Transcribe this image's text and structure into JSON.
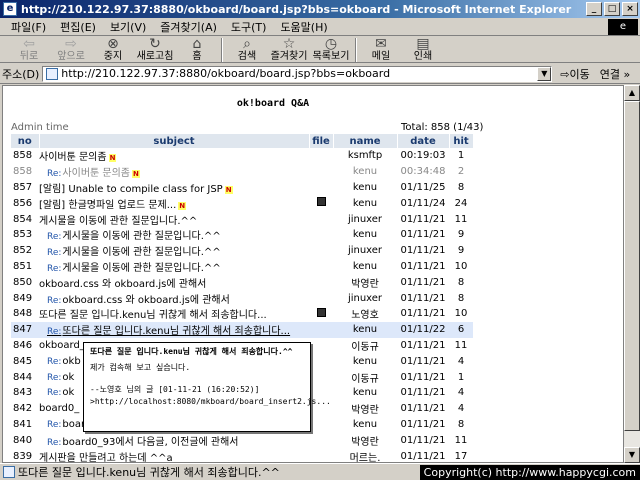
{
  "window": {
    "title": "http://210.122.97.37:8880/okboard/board.jsp?bbs=okboard - Microsoft Internet Explorer"
  },
  "menu": [
    "파일(F)",
    "편집(E)",
    "보기(V)",
    "즐겨찾기(A)",
    "도구(T)",
    "도움말(H)"
  ],
  "toolbar": {
    "back": "뒤로",
    "forward": "앞으로",
    "stop": "중지",
    "refresh": "새로고침",
    "home": "홈",
    "search": "검색",
    "favorites": "즐겨찾기",
    "history": "목록보기",
    "mail": "메일",
    "print": "인쇄"
  },
  "address": {
    "label": "주소(D)",
    "url": "http://210.122.97.37:8880/okboard/board.jsp?bbs=okboard",
    "go": "이동",
    "links": "연결 »"
  },
  "board": {
    "title": "ok!board Q&A",
    "admin": "Admin time",
    "total": "Total: 858 (1/43)",
    "headers": {
      "no": "no",
      "subject": "subject",
      "file": "file",
      "name": "name",
      "date": "date",
      "hit": "hit"
    },
    "new_badge": "N",
    "re_prefix": "Re:",
    "rows": [
      {
        "no": "858",
        "subject": "사이버툰 문의좀",
        "re": false,
        "new": true,
        "file": false,
        "name": "ksmftp",
        "date": "00:19:03",
        "hit": "1",
        "grey": false
      },
      {
        "no": "858",
        "subject": "사이버툰 문의좀",
        "re": true,
        "new": true,
        "file": false,
        "name": "kenu",
        "date": "00:34:48",
        "hit": "2",
        "grey": true
      },
      {
        "no": "857",
        "subject": "[알림] Unable to compile class for JSP",
        "re": false,
        "new": true,
        "file": false,
        "name": "kenu",
        "date": "01/11/25",
        "hit": "8",
        "grey": false
      },
      {
        "no": "856",
        "subject": "[알림] 한글명파일 업로드 문제...",
        "re": false,
        "new": true,
        "file": true,
        "name": "kenu",
        "date": "01/11/24",
        "hit": "24",
        "grey": false
      },
      {
        "no": "854",
        "subject": "게시물을 이동에 관한 질문입니다.^^",
        "re": false,
        "new": false,
        "file": false,
        "name": "jinuxer",
        "date": "01/11/21",
        "hit": "11",
        "grey": false
      },
      {
        "no": "853",
        "subject": "게시물을 이동에 관한 질문입니다.^^",
        "re": true,
        "new": false,
        "file": false,
        "name": "kenu",
        "date": "01/11/21",
        "hit": "9",
        "grey": false
      },
      {
        "no": "852",
        "subject": "게시물을 이동에 관한 질문입니다.^^",
        "re": true,
        "new": false,
        "file": false,
        "name": "jinuxer",
        "date": "01/11/21",
        "hit": "9",
        "grey": false
      },
      {
        "no": "851",
        "subject": "게시물을 이동에 관한 질문입니다.^^",
        "re": true,
        "new": false,
        "file": false,
        "name": "kenu",
        "date": "01/11/21",
        "hit": "10",
        "grey": false
      },
      {
        "no": "850",
        "subject": "okboard.css 와 okboard.js에 관해서",
        "re": false,
        "new": false,
        "file": false,
        "name": "박영란",
        "date": "01/11/21",
        "hit": "8",
        "grey": false
      },
      {
        "no": "849",
        "subject": "okboard.css 와 okboard.js에 관해서",
        "re": true,
        "new": false,
        "file": false,
        "name": "jinuxer",
        "date": "01/11/21",
        "hit": "8",
        "grey": false
      },
      {
        "no": "848",
        "subject": "또다른 질문 입니다.kenu님 귀찮게 해서 죄송합니다...",
        "re": false,
        "new": false,
        "file": true,
        "name": "노영호",
        "date": "01/11/21",
        "hit": "10",
        "grey": false
      },
      {
        "no": "847",
        "subject": "또다른 질문 입니다.kenu님 귀찮게 해서 죄송합니다...",
        "re": true,
        "new": false,
        "file": false,
        "name": "kenu",
        "date": "01/11/22",
        "hit": "6",
        "grey": false,
        "hover": true
      },
      {
        "no": "846",
        "subject": "okboard_... ",
        "re": false,
        "new": false,
        "file": false,
        "name": "이동규",
        "date": "01/11/21",
        "hit": "11",
        "grey": false
      },
      {
        "no": "845",
        "subject": "okb",
        "re": true,
        "new": false,
        "file": false,
        "name": "kenu",
        "date": "01/11/21",
        "hit": "4",
        "grey": false
      },
      {
        "no": "844",
        "subject": "ok",
        "re": true,
        "new": false,
        "file": false,
        "name": "이동규",
        "date": "01/11/21",
        "hit": "1",
        "grey": false
      },
      {
        "no": "843",
        "subject": "ok",
        "re": true,
        "new": false,
        "file": false,
        "name": "kenu",
        "date": "01/11/21",
        "hit": "4",
        "grey": false
      },
      {
        "no": "842",
        "subject": "board0_",
        "re": false,
        "new": false,
        "file": false,
        "name": "박영란",
        "date": "01/11/21",
        "hit": "4",
        "grey": false
      },
      {
        "no": "841",
        "subject": "boar",
        "re": true,
        "new": false,
        "file": false,
        "name": "kenu",
        "date": "01/11/21",
        "hit": "8",
        "grey": false
      },
      {
        "no": "840",
        "subject": "board0_93에서 다음글, 이전글에 관해서",
        "re": true,
        "new": false,
        "file": false,
        "name": "박영란",
        "date": "01/11/21",
        "hit": "11",
        "grey": false
      },
      {
        "no": "839",
        "subject": "게시판을 만들려고 하는데 ^^a",
        "re": false,
        "new": false,
        "file": false,
        "name": "머르는.",
        "date": "01/11/21",
        "hit": "17",
        "grey": false
      }
    ]
  },
  "tooltip": {
    "title": "또다른 질문 입니다.kenu님 귀찮게 해서 죄송합니다.^^",
    "body": "제가 컴속해 보고 싶습니다.",
    "quote": "--노영호 님의 글 [01-11-21 (16:20:52)]",
    "url": ">http://localhost:8080/mkboard/board_insert2.js..."
  },
  "status": {
    "text": "또다른 질문 입니다.kenu님 귀찮게 해서 죄송합니다.^^",
    "copyright": "Copyright(c) http://www.happycgi.com"
  }
}
